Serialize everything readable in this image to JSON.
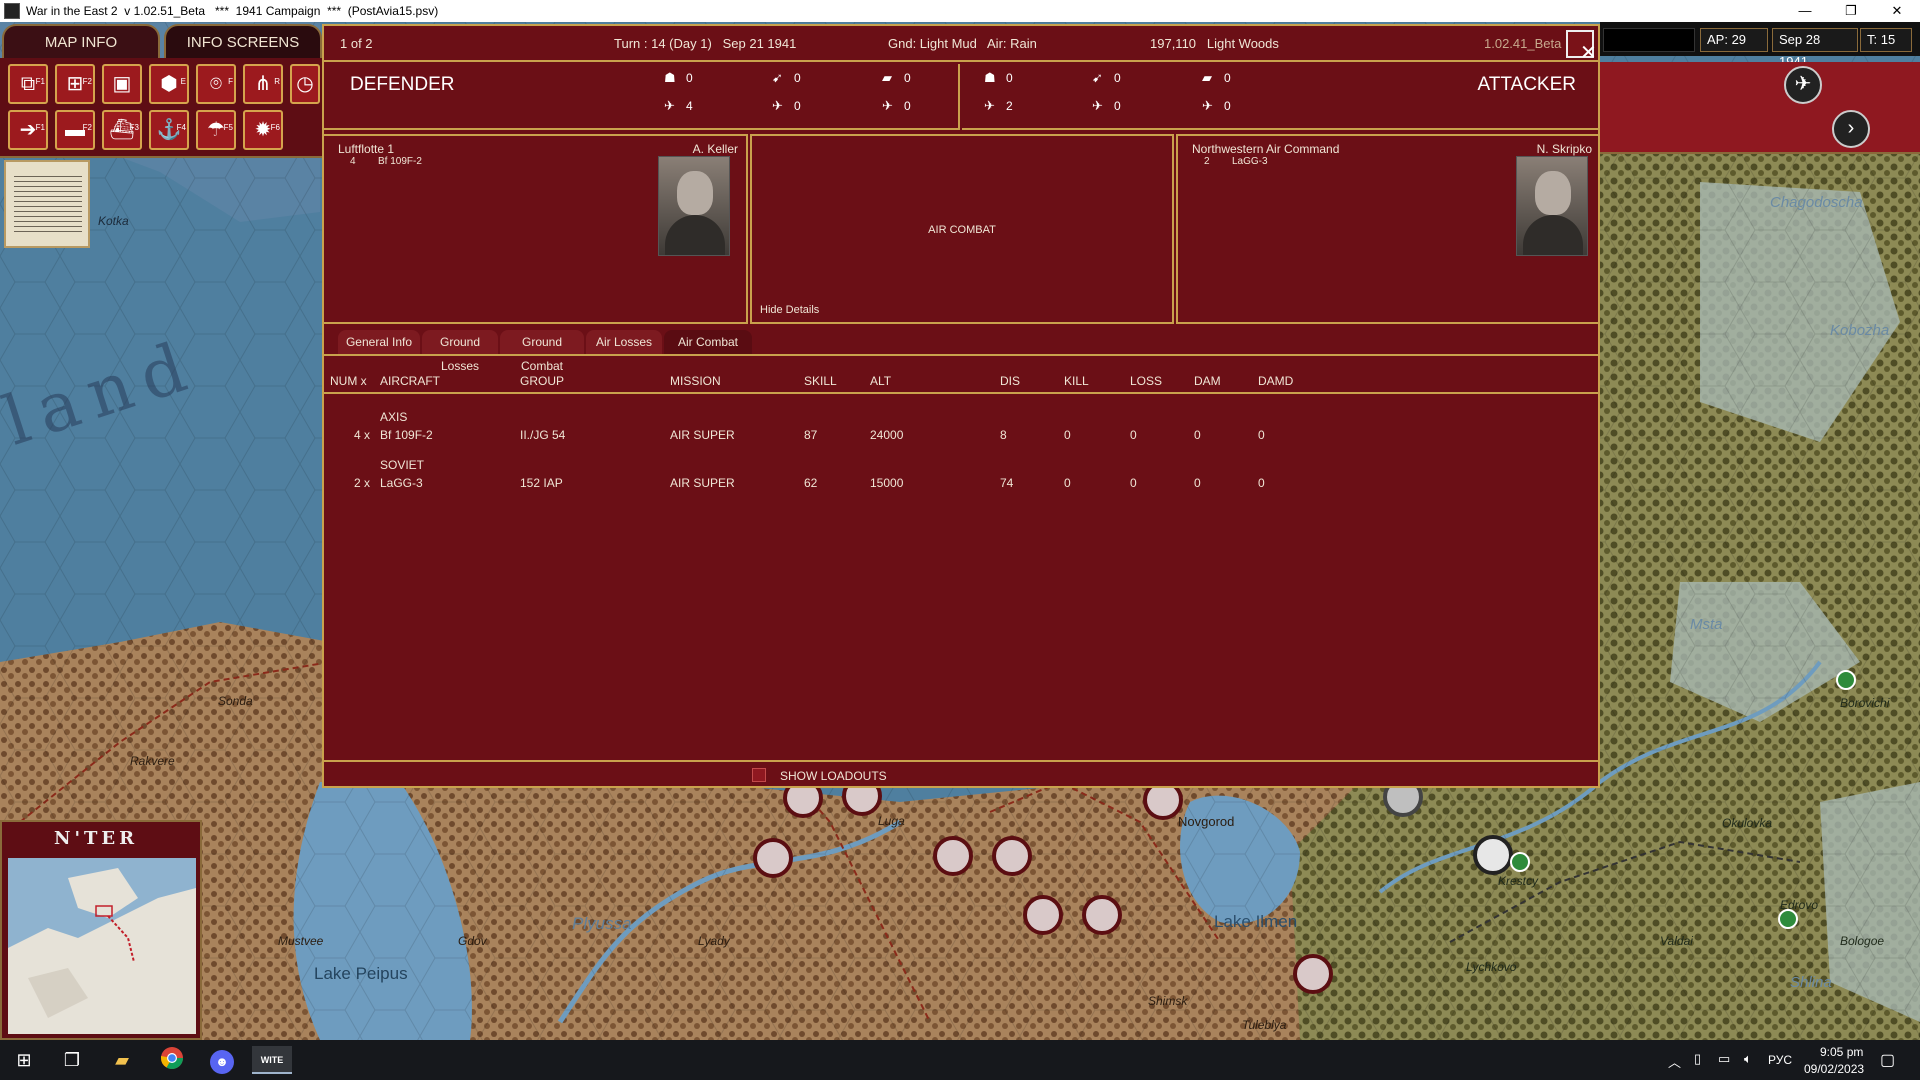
{
  "window": {
    "title": "War in the East 2  v 1.02.51_Beta   ***  1941 Campaign  ***  (PostAvia15.psv)",
    "minimize": "—",
    "maximize": "❐",
    "close": "✕"
  },
  "nav": {
    "map_info": "MAP INFO",
    "info_screens": "INFO SCREENS"
  },
  "toolbar": {
    "row1": [
      {
        "icon": "unit-swap-icon",
        "glyph": "⧉",
        "key": "F1"
      },
      {
        "icon": "add-unit-icon",
        "glyph": "⊞",
        "key": "F2"
      },
      {
        "icon": "folder-icon",
        "glyph": "▣",
        "key": ""
      },
      {
        "icon": "hex-icon",
        "glyph": "⬢",
        "key": "E"
      },
      {
        "icon": "target-icon",
        "glyph": "⌾",
        "key": "F"
      },
      {
        "icon": "rail-icon",
        "glyph": "⋔",
        "key": "R"
      },
      {
        "icon": "clock-icon",
        "glyph": "◷",
        "key": ""
      }
    ],
    "row2": [
      {
        "icon": "move-arrow-icon",
        "glyph": "➔",
        "key": "F1"
      },
      {
        "icon": "tank-icon",
        "glyph": "▬",
        "key": "F2"
      },
      {
        "icon": "ship-icon",
        "glyph": "⛴",
        "key": "F3"
      },
      {
        "icon": "naval-icon",
        "glyph": "⚓",
        "key": "F4"
      },
      {
        "icon": "paradrop-icon",
        "glyph": "☂",
        "key": "F5"
      },
      {
        "icon": "explosion-icon",
        "glyph": "✹",
        "key": "F6"
      }
    ]
  },
  "header": {
    "page": "1 of 2",
    "turn": "Turn : 14 (Day 1)   Sep 21 1941",
    "weather": "Gnd: Light Mud   Air: Rain",
    "location": "197,110   Light Woods",
    "version": "1.02.41_Beta",
    "close_glyph": "✕"
  },
  "right_strip": {
    "ap": "AP: 29",
    "date": "Sep 28 1941",
    "turns": "T: 15"
  },
  "defender": {
    "label": "DEFENDER",
    "stats": {
      "infantry": "0",
      "fighter_top": "0",
      "tank": "0",
      "bomber_a": "4",
      "bomber_b": "0",
      "bomber_c": "0"
    },
    "command": "Luftflotte 1",
    "commander": "A. Keller",
    "unit_count": "4",
    "unit_type": "Bf 109F-2"
  },
  "attacker": {
    "label": "ATTACKER",
    "stats": {
      "infantry": "0",
      "fighter_top": "0",
      "tank": "0",
      "bomber_a": "2",
      "bomber_b": "0",
      "bomber_c": "0"
    },
    "command": "Northwestern Air Command",
    "commander": "N. Skripko",
    "unit_count": "2",
    "unit_type": "LaGG-3"
  },
  "center": {
    "title": "AIR COMBAT",
    "hide_details": "Hide Details"
  },
  "tabs": [
    "General Info",
    "Ground Losses",
    "Ground Combat",
    "Air Losses",
    "Air Combat"
  ],
  "table": {
    "headers": [
      "NUM x",
      "AIRCRAFT",
      "GROUP",
      "MISSION",
      "SKILL",
      "ALT",
      "DIS",
      "KILL",
      "LOSS",
      "DAM",
      "DAMD"
    ],
    "rows": [
      {
        "side": "AXIS",
        "num": "4 x",
        "aircraft": "Bf 109F-2",
        "group": "II./JG 54",
        "mission": "AIR SUPER",
        "skill": "87",
        "alt": "24000",
        "dis": "8",
        "kill": "0",
        "loss": "0",
        "dam": "0",
        "damd": "0"
      },
      {
        "side": "SOVIET",
        "num": "2 x",
        "aircraft": "LaGG-3",
        "group": "152 IAP",
        "mission": "AIR SUPER",
        "skill": "62",
        "alt": "15000",
        "dis": "74",
        "kill": "0",
        "loss": "0",
        "dam": "0",
        "damd": "0"
      }
    ]
  },
  "loadouts": {
    "label": "SHOW LOADOUTS"
  },
  "map_labels": {
    "finland": "land",
    "kotka": "Kotka",
    "sonda": "Sonda",
    "rakvere": "Rakvere",
    "mustvee": "Mustvee",
    "gdov": "Gdov",
    "lake_peipus": "Lake Peipus",
    "plyussa": "Plyussa",
    "lyady": "Lyady",
    "luga": "Luga",
    "novgorod": "Novgorod",
    "lake_ilmen": "Lake Ilmen",
    "shimsk": "Shimsk",
    "tuleblya": "Tuleblya",
    "krestcy": "Krestcy",
    "lychkovo": "Lychkovo",
    "valdai": "Valdai",
    "okulovka": "Okulovka",
    "borovichi": "Borovichi",
    "edrovo": "Edrovo",
    "bologoe": "Bologoe",
    "chagodoscha": "Chagodoscha",
    "kobozha": "Kobozha",
    "msta": "Msta",
    "shlina": "Shlina"
  },
  "minimap": {
    "title": "N'TER"
  },
  "taskbar": {
    "lang": "РУС",
    "time": "9:05 pm",
    "date": "09/02/2023",
    "app_label": "WITE"
  },
  "colors": {
    "panel": "#6b0f16",
    "border": "#c9a24d",
    "text": "#f0e6d6"
  }
}
